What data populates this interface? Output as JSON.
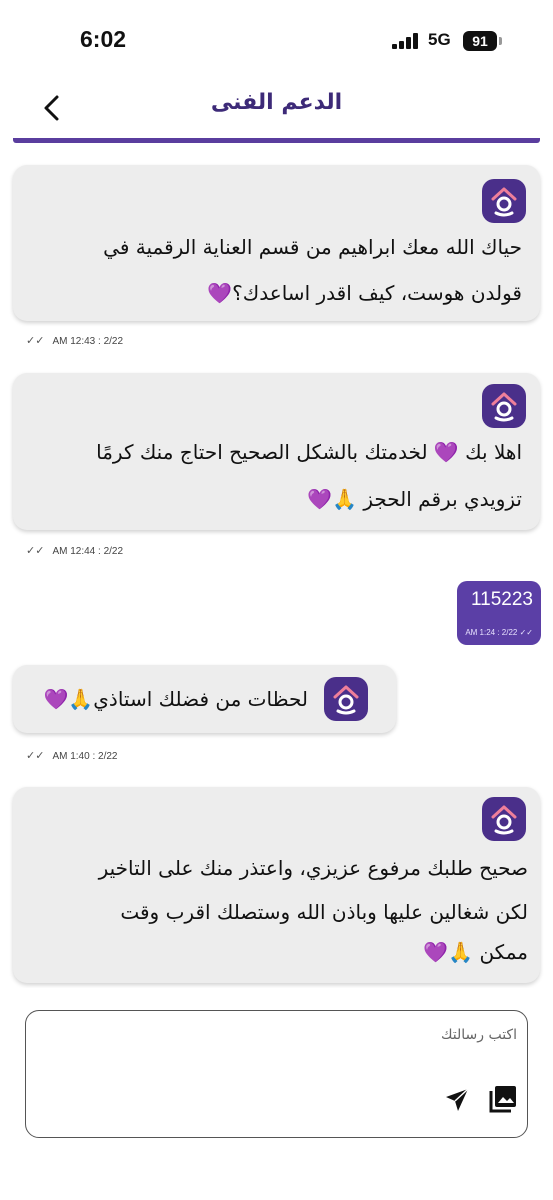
{
  "status_bar": {
    "time": "6:02",
    "network": "5G",
    "battery": "91"
  },
  "header": {
    "title": "الدعم الفنى"
  },
  "messages": [
    {
      "text_line1": "حياك الله معك ابراهيم من قسم العناية الرقمية في",
      "text_line2": "قولدن هوست، كيف اقدر اساعدك؟💜",
      "time": "AM 12:43 : 2/22"
    },
    {
      "text_line1": "اهلا بك 💜 لخدمتك بالشكل الصحيح احتاج منك كرمًا",
      "text_line2": "تزويدي برقم الحجز 🙏💜",
      "time": "AM 12:44 : 2/22"
    },
    {
      "text": "115223",
      "time": "AM 1:24 : 2/22",
      "sent": true
    },
    {
      "text_line1": "لحظات من فضلك استاذي🙏💜",
      "time": "AM 1:40 : 2/22"
    },
    {
      "text_line1": "صحيح طلبك مرفوع عزيزي، واعتذر منك على التاخير",
      "text_line2": "لكن شغالين عليها وباذن الله وستصلك اقرب وقت",
      "text_line3": "ممكن 🙏💜"
    }
  ],
  "composer": {
    "placeholder": "اكتب رسالتك"
  },
  "colors": {
    "brand": "#5b3fa6",
    "title": "#3d2a78",
    "bubble": "#ededed"
  },
  "icons": {
    "back": "chevron-left-icon",
    "send": "send-icon",
    "image": "image-icon",
    "avatar": "house-logo-icon"
  }
}
